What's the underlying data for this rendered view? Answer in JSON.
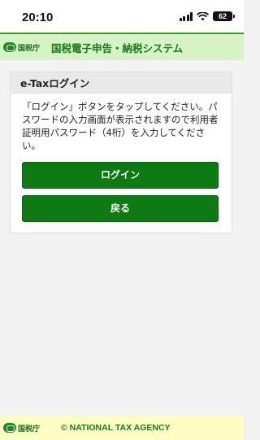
{
  "status_bar": {
    "time": "20:10",
    "battery": "62"
  },
  "header": {
    "logo_text": "国税庁",
    "title": "国税電子申告・納税システム"
  },
  "card": {
    "title": "e-Taxログイン",
    "instructions": "「ログイン」ボタンをタップしてください。パスワードの入力画面が表示されますので利用者証明用パスワード（4桁）を入力してください。",
    "login_label": "ログイン",
    "back_label": "戻る"
  },
  "footer": {
    "logo_text": "国税庁",
    "copyright": "© NATIONAL TAX AGENCY"
  },
  "colors": {
    "accent_green": "#0e7a14",
    "header_bg": "#d6f3c6",
    "footer_bg": "#fdfdc4"
  }
}
